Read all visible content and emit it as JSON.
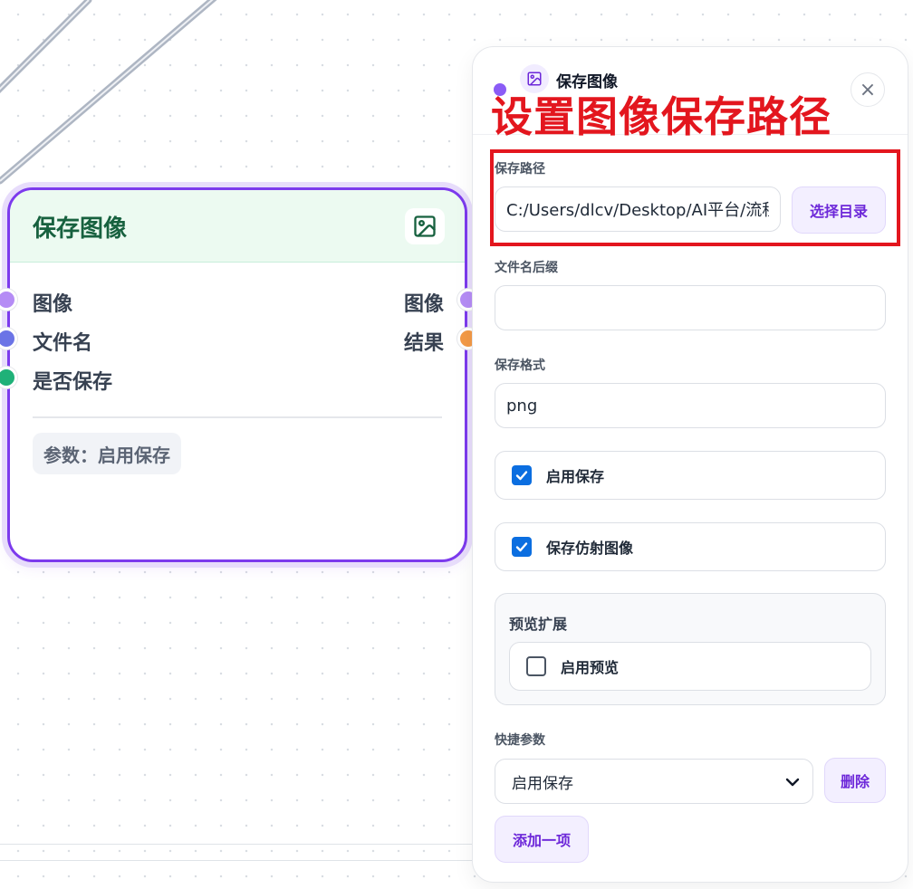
{
  "node": {
    "title": "保存图像",
    "inputs": [
      "图像",
      "文件名",
      "是否保存"
    ],
    "outputs": [
      "图像",
      "结果"
    ],
    "param_badge": "参数：启用保存",
    "port_colors": {
      "image": "#b58cf5",
      "filename": "#6b74e6",
      "save_flag": "#1fb178",
      "result": "#f39a46"
    }
  },
  "panel": {
    "title": "保存图像",
    "close_symbol": "×",
    "overlay_note": "设置图像保存路径",
    "save_path": {
      "label": "保存路径",
      "value": "C:/Users/dlcv/Desktop/AI平台/流程",
      "browse_label": "选择目录"
    },
    "suffix": {
      "label": "文件名后缀",
      "value": ""
    },
    "format": {
      "label": "保存格式",
      "value": "png"
    },
    "enable_save": {
      "label": "启用保存",
      "checked": true
    },
    "save_affine": {
      "label": "保存仿射图像",
      "checked": true
    },
    "preview": {
      "title": "预览扩展",
      "enable_preview": {
        "label": "启用预览",
        "checked": false
      }
    },
    "quick_params": {
      "label": "快捷参数",
      "selected": "启用保存",
      "delete_label": "删除",
      "add_label": "添加一项"
    }
  },
  "colors": {
    "accent": "#7c3aed",
    "alert": "#e3161e",
    "checkbox": "#0b6ee0",
    "node_title": "#17613f"
  }
}
